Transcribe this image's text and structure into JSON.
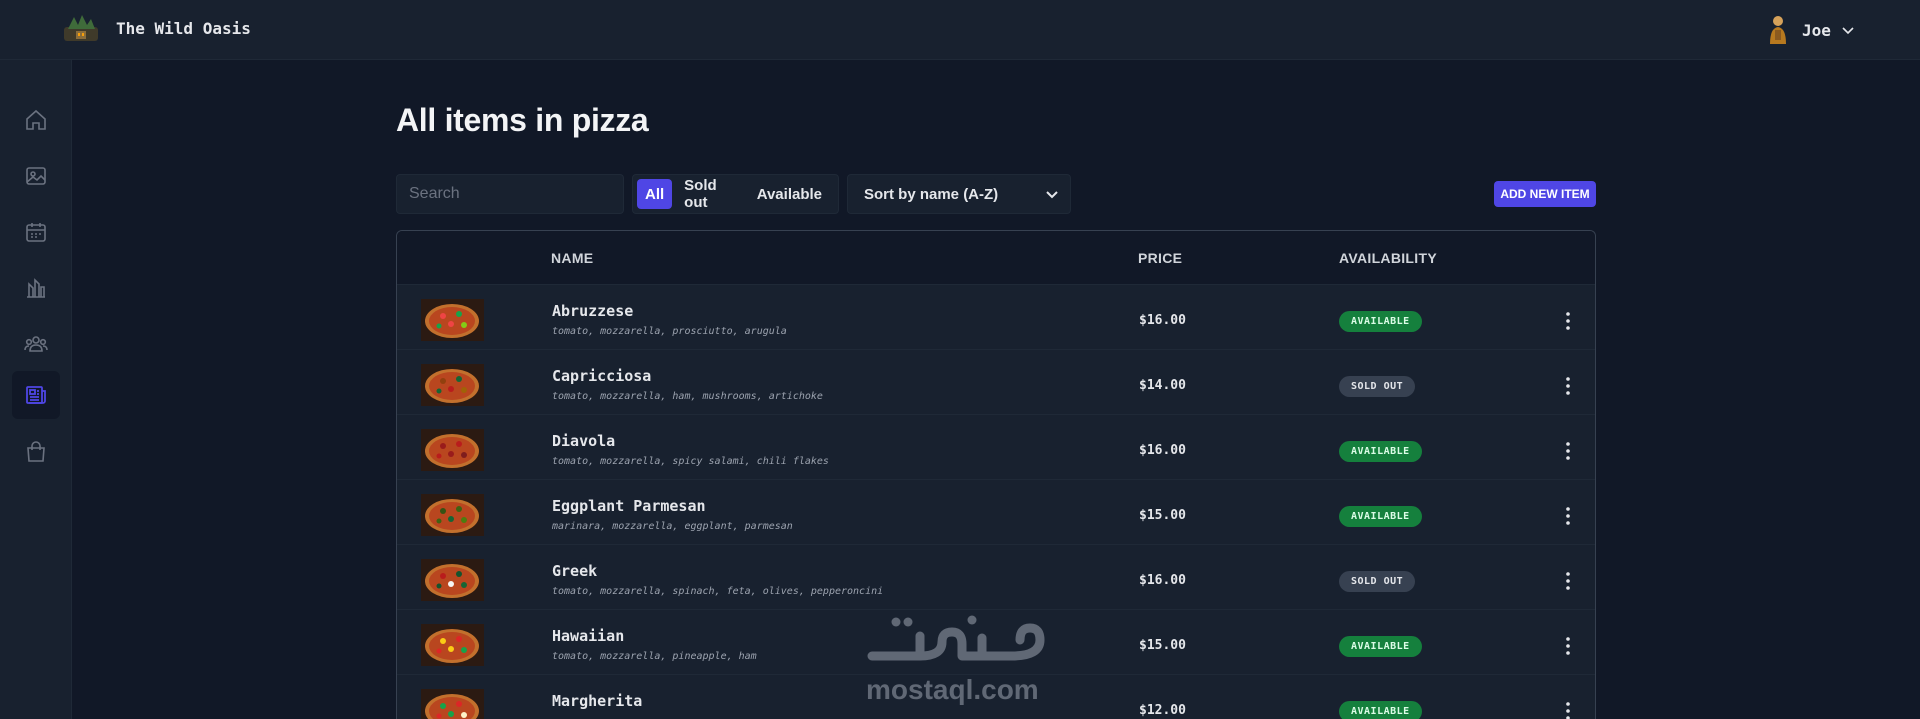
{
  "header": {
    "app_name": "The Wild Oasis",
    "user": {
      "name": "Joe"
    }
  },
  "sidebar": {
    "items": [
      {
        "icon": "home-icon",
        "active": false
      },
      {
        "icon": "image-icon",
        "active": false
      },
      {
        "icon": "calendar-icon",
        "active": false
      },
      {
        "icon": "chart-icon",
        "active": false
      },
      {
        "icon": "users-icon",
        "active": false
      },
      {
        "icon": "newspaper-icon",
        "active": true
      },
      {
        "icon": "shopping-bag-icon",
        "active": false
      }
    ]
  },
  "main": {
    "title": "All items in pizza",
    "search": {
      "placeholder": "Search",
      "value": ""
    },
    "filters": [
      "All",
      "Sold out",
      "Available"
    ],
    "active_filter": "All",
    "sort": {
      "selected": "Sort by name (A-Z)"
    },
    "add_button": "ADD NEW ITEM",
    "colors": {
      "accent": "#4f46e5",
      "available": "#15803d",
      "sold_out": "#374151"
    }
  },
  "table": {
    "headers": [
      "NAME",
      "PRICE",
      "AVAILABILITY"
    ],
    "rows": [
      {
        "name": "Abruzzese",
        "ingredients": "tomato, mozzarella, prosciutto, arugula",
        "price": "$16.00",
        "status": "AVAILABLE"
      },
      {
        "name": "Capricciosa",
        "ingredients": "tomato, mozzarella, ham, mushrooms, artichoke",
        "price": "$14.00",
        "status": "SOLD OUT"
      },
      {
        "name": "Diavola",
        "ingredients": "tomato, mozzarella, spicy salami, chili flakes",
        "price": "$16.00",
        "status": "AVAILABLE"
      },
      {
        "name": "Eggplant Parmesan",
        "ingredients": "marinara, mozzarella, eggplant, parmesan",
        "price": "$15.00",
        "status": "AVAILABLE"
      },
      {
        "name": "Greek",
        "ingredients": "tomato, mozzarella, spinach, feta, olives, pepperoncini",
        "price": "$16.00",
        "status": "SOLD OUT"
      },
      {
        "name": "Hawaiian",
        "ingredients": "tomato, mozzarella, pineapple, ham",
        "price": "$15.00",
        "status": "AVAILABLE"
      },
      {
        "name": "Margherita",
        "ingredients": "",
        "price": "$12.00",
        "status": "AVAILABLE"
      }
    ]
  },
  "watermark": {
    "arabic": "مستقل",
    "latin": "mostaql.com"
  }
}
